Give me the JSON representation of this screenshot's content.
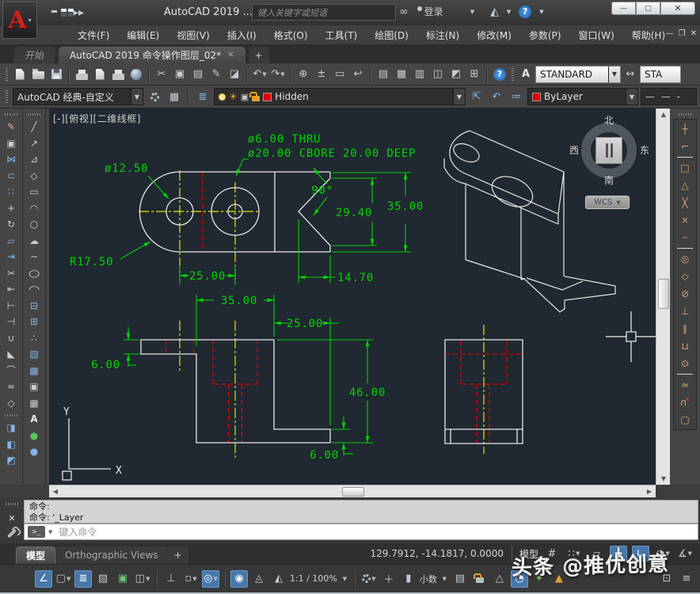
{
  "title_bar": {
    "app_title": "AutoCAD 2019 ...",
    "search_placeholder": "键入关键字或短语",
    "login_label": "登录"
  },
  "menu_bar": {
    "items": [
      "文件(F)",
      "编辑(E)",
      "视图(V)",
      "插入(I)",
      "格式(O)",
      "工具(T)",
      "绘图(D)",
      "标注(N)",
      "修改(M)",
      "参数(P)",
      "窗口(W)",
      "帮助(H)"
    ]
  },
  "file_tabs": {
    "start": "开始",
    "document": "AutoCAD 2019 命令操作图层_02*",
    "new_tab": "+"
  },
  "toolbars": {
    "text_style_name": "STANDARD",
    "dim_style_name": "STA",
    "workspace_name": "AutoCAD 经典-自定义",
    "layer_name": "Hidden",
    "color_name": "ByLayer",
    "linetype_preview": "—  —  -"
  },
  "viewport": {
    "label": "[-][俯视][二维线框]",
    "wcs_label": "WCS",
    "ucs_x": "X",
    "ucs_y": "Y",
    "viewcube": {
      "north": "北",
      "south": "南",
      "east": "东",
      "west": "西"
    }
  },
  "drawing": {
    "dims": {
      "hole_note_line1": "ø6.00 THRU",
      "hole_note_line2": "ø20.00 CBORE 20.00 DEEP",
      "dia_12_50": "ø12.50",
      "rad_17_50": "R17.50",
      "top_25": "25.00",
      "angle_90": "90°",
      "len_29_40": "29.40",
      "top_35": "35.00",
      "len_14_70": "14.70",
      "front_35": "35.00",
      "front_25": "25.00",
      "front_6_left": "6.00",
      "front_46": "46.00",
      "front_6_bottom": "6.00"
    }
  },
  "command_line": {
    "history": [
      "命令:",
      "命令: '_Layer"
    ],
    "placeholder": "键入命令"
  },
  "layout_tabs": {
    "model": "模型",
    "ortho": "Orthographic Views",
    "new_layout": "+"
  },
  "status_bar": {
    "coordinates": "129.7912, -14.1817, 0.0000",
    "model_label": "模型",
    "annotation_scale": "1:1 / 100%",
    "units": "小数"
  },
  "watermark": {
    "text": "头条 @推优创意"
  },
  "colors": {
    "dimension_green": "#00d400",
    "centerline_yellow": "#e6e600",
    "hidden_red": "#e00000",
    "geometry_white": "#e8e8e8",
    "status_highlight_blue": "#4878a8",
    "layer_color_swatch": "#e00000",
    "canvas_background": "#202831"
  }
}
